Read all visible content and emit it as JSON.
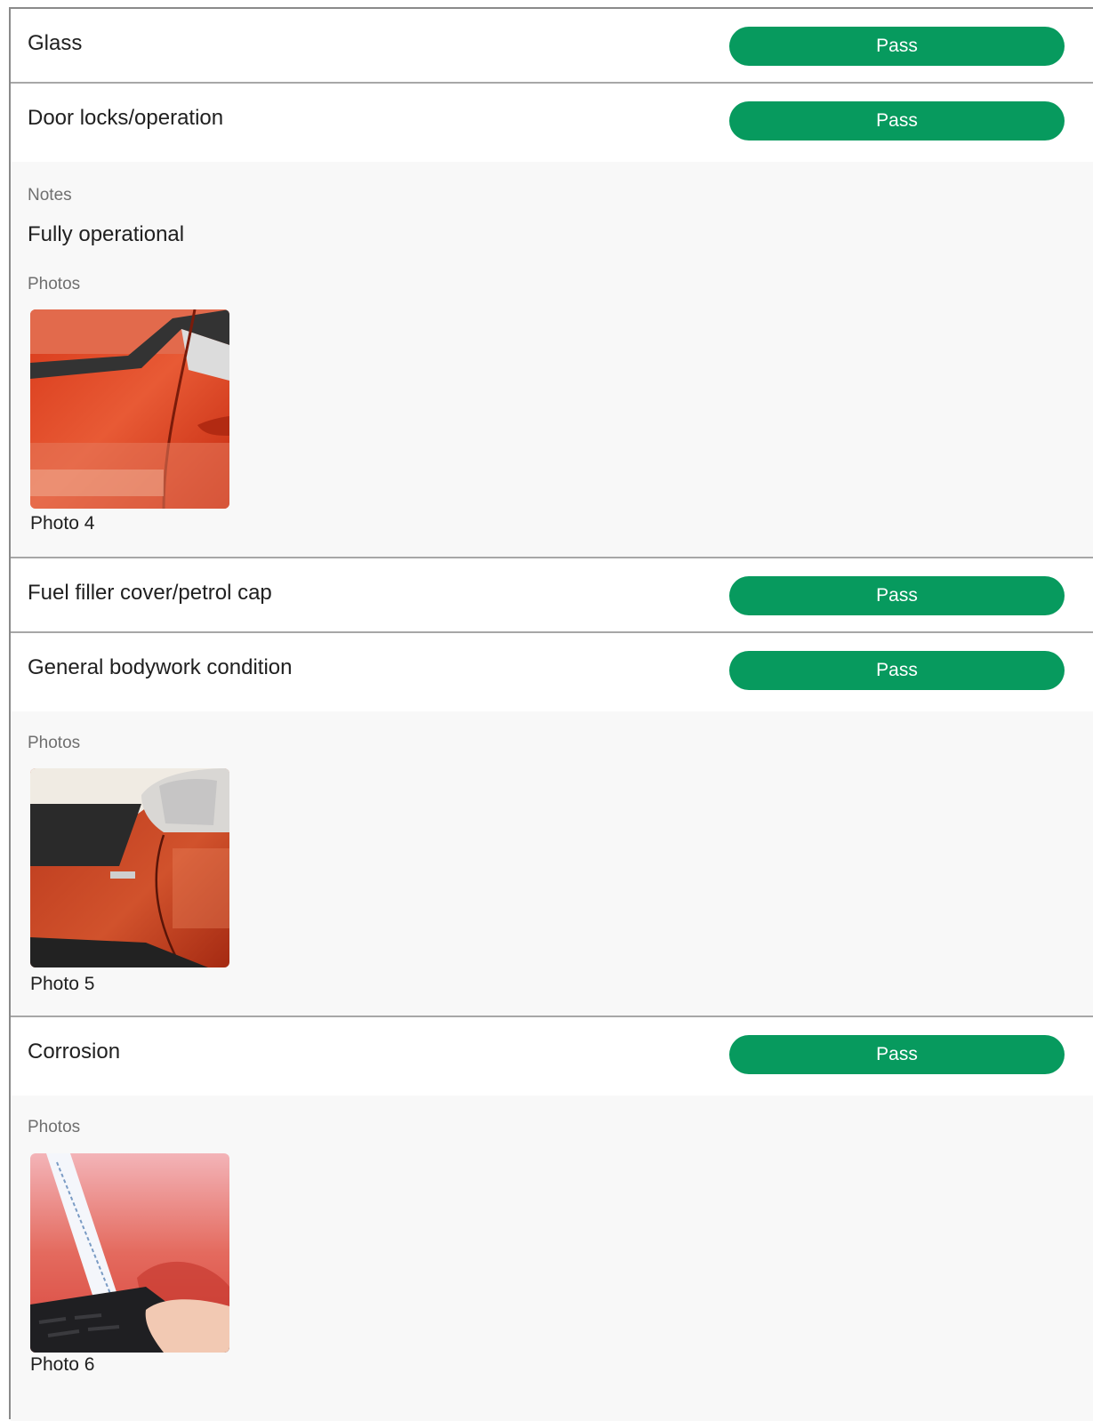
{
  "items": [
    {
      "label": "Glass",
      "status": "Pass"
    },
    {
      "label": "Door locks/operation",
      "status": "Pass",
      "notes_label": "Notes",
      "notes": "Fully operational",
      "photos_label": "Photos",
      "photos": [
        {
          "caption": "Photo 4"
        }
      ]
    },
    {
      "label": "Fuel filler cover/petrol cap",
      "status": "Pass"
    },
    {
      "label": "General bodywork condition",
      "status": "Pass",
      "photos_label": "Photos",
      "photos": [
        {
          "caption": "Photo 5"
        }
      ]
    },
    {
      "label": "Corrosion",
      "status": "Pass",
      "photos_label": "Photos",
      "photos": [
        {
          "caption": "Photo 6"
        }
      ]
    }
  ],
  "colors": {
    "pass": "#079a5e",
    "divider": "#a7a7a7",
    "details_bg": "#f8f8f8"
  }
}
